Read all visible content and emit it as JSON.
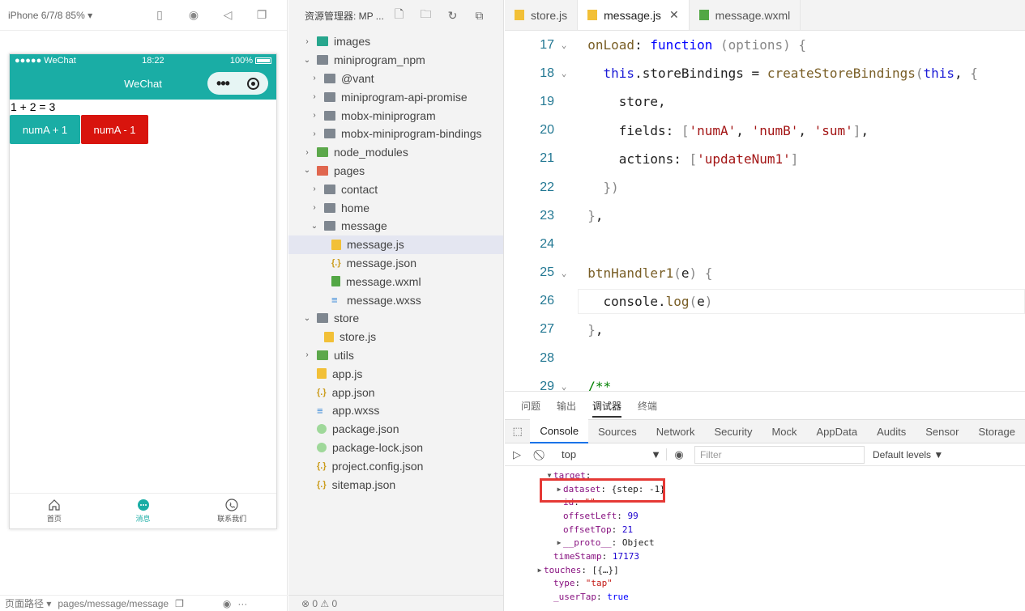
{
  "simulator": {
    "device": "iPhone 6/7/8 85% ▾",
    "status": {
      "carrier": "●●●●● WeChat",
      "time": "18:22",
      "battery": "100%"
    },
    "nav_title": "WeChat",
    "sum_text": "1 + 2 = 3",
    "btn_plus": "numA + 1",
    "btn_minus": "numA - 1",
    "tabbar": [
      {
        "label": "首页"
      },
      {
        "label": "消息"
      },
      {
        "label": "联系我们"
      }
    ],
    "footer_label": "页面路径 ▾",
    "footer_path": "pages/message/message"
  },
  "explorer": {
    "title": "资源管理器: MP ...",
    "footer_status": "⊗ 0 ⚠ 0",
    "tree": [
      {
        "label": "images",
        "depth": 0,
        "chev": "›",
        "icon": "folder img"
      },
      {
        "label": "miniprogram_npm",
        "depth": 0,
        "chev": "⌄",
        "icon": "folder"
      },
      {
        "label": "@vant",
        "depth": 1,
        "chev": "›",
        "icon": "folder"
      },
      {
        "label": "miniprogram-api-promise",
        "depth": 1,
        "chev": "›",
        "icon": "folder"
      },
      {
        "label": "mobx-miniprogram",
        "depth": 1,
        "chev": "›",
        "icon": "folder"
      },
      {
        "label": "mobx-miniprogram-bindings",
        "depth": 1,
        "chev": "›",
        "icon": "folder"
      },
      {
        "label": "node_modules",
        "depth": 0,
        "chev": "›",
        "icon": "folder green"
      },
      {
        "label": "pages",
        "depth": 0,
        "chev": "⌄",
        "icon": "folder red"
      },
      {
        "label": "contact",
        "depth": 1,
        "chev": "›",
        "icon": "folder"
      },
      {
        "label": "home",
        "depth": 1,
        "chev": "›",
        "icon": "folder"
      },
      {
        "label": "message",
        "depth": 1,
        "chev": "⌄",
        "icon": "folder"
      },
      {
        "label": "message.js",
        "depth": 2,
        "chev": "",
        "icon": "fjs",
        "selected": true
      },
      {
        "label": "message.json",
        "depth": 2,
        "chev": "",
        "icon": "fjson"
      },
      {
        "label": "message.wxml",
        "depth": 2,
        "chev": "",
        "icon": "fwxml"
      },
      {
        "label": "message.wxss",
        "depth": 2,
        "chev": "",
        "icon": "fwxss"
      },
      {
        "label": "store",
        "depth": 0,
        "chev": "⌄",
        "icon": "folder"
      },
      {
        "label": "store.js",
        "depth": 1,
        "chev": "",
        "icon": "fjs"
      },
      {
        "label": "utils",
        "depth": 0,
        "chev": "›",
        "icon": "folder green"
      },
      {
        "label": "app.js",
        "depth": 0,
        "chev": "",
        "icon": "fjs"
      },
      {
        "label": "app.json",
        "depth": 0,
        "chev": "",
        "icon": "fjson"
      },
      {
        "label": "app.wxss",
        "depth": 0,
        "chev": "",
        "icon": "fwxss"
      },
      {
        "label": "package.json",
        "depth": 0,
        "chev": "",
        "icon": "fpkg"
      },
      {
        "label": "package-lock.json",
        "depth": 0,
        "chev": "",
        "icon": "fpkg"
      },
      {
        "label": "project.config.json",
        "depth": 0,
        "chev": "",
        "icon": "fjson"
      },
      {
        "label": "sitemap.json",
        "depth": 0,
        "chev": "",
        "icon": "fjson"
      }
    ]
  },
  "editor": {
    "tabs": [
      {
        "label": "store.js",
        "icon": "fjs"
      },
      {
        "label": "message.js",
        "icon": "fjs",
        "active": true
      },
      {
        "label": "message.wxml",
        "icon": "fwxml"
      }
    ],
    "lines": [
      {
        "n": "17",
        "fold": "⌄",
        "code": "  <span class='f'>onLoad</span>: <span class='kw2'>function</span> <span class='p'>(options)</span> <span class='p'>{</span>"
      },
      {
        "n": "18",
        "fold": "⌄",
        "code": "    <span class='k'>this</span>.storeBindings = <span class='f'>createStoreBindings</span><span class='p'>(</span><span class='k'>this</span>, <span class='p'>{</span>"
      },
      {
        "n": "19",
        "fold": "",
        "code": "      store,"
      },
      {
        "n": "20",
        "fold": "",
        "code": "      fields: <span class='p'>[</span><span class='s'>'numA'</span>, <span class='s'>'numB'</span>, <span class='s'>'sum'</span><span class='p'>]</span>,"
      },
      {
        "n": "21",
        "fold": "",
        "code": "      actions: <span class='p'>[</span><span class='s'>'updateNum1'</span><span class='p'>]</span>"
      },
      {
        "n": "22",
        "fold": "",
        "code": "    <span class='p'>})</span>"
      },
      {
        "n": "23",
        "fold": "",
        "code": "  <span class='p'>}</span>,"
      },
      {
        "n": "24",
        "fold": "",
        "code": ""
      },
      {
        "n": "25",
        "fold": "⌄",
        "code": "  <span class='f'>btnHandler1</span><span class='p'>(</span>e<span class='p'>)</span> <span class='p'>{</span>"
      },
      {
        "n": "26",
        "fold": "",
        "code": "    console.<span class='f'>log</span><span class='p'>(</span>e<span class='p'>)</span>",
        "current": true
      },
      {
        "n": "27",
        "fold": "",
        "code": "  <span class='p'>}</span>,"
      },
      {
        "n": "28",
        "fold": "",
        "code": ""
      },
      {
        "n": "29",
        "fold": "⌄",
        "code": "  <span class='cmt'>/**</span>"
      }
    ]
  },
  "debug": {
    "tabs": [
      "问题",
      "输出",
      "调试器",
      "终端"
    ],
    "active_tab": "调试器",
    "console_tabs": [
      "Console",
      "Sources",
      "Network",
      "Security",
      "Mock",
      "AppData",
      "Audits",
      "Sensor",
      "Storage"
    ],
    "context": "top",
    "filter_placeholder": "Filter",
    "levels": "Default levels ▼",
    "output": [
      {
        "indent": 2,
        "tri": "▼",
        "html": "<span class='key'>target</span>:"
      },
      {
        "indent": 3,
        "tri": "▶",
        "html": "<span class='key'>dataset</span>: {step: -1}"
      },
      {
        "indent": 3,
        "tri": "",
        "html": "<span class='key'>id</span>: <span class='str'>\"\"</span>"
      },
      {
        "indent": 3,
        "tri": "",
        "html": "<span class='key'>offsetLeft</span>: <span class='num'>99</span>"
      },
      {
        "indent": 3,
        "tri": "",
        "html": "<span class='key'>offsetTop</span>: <span class='num'>21</span>"
      },
      {
        "indent": 3,
        "tri": "▶",
        "html": "<span class='key'>__proto__</span>: Object"
      },
      {
        "indent": 2,
        "tri": "",
        "html": "<span class='key'>timeStamp</span>: <span class='num'>17173</span>"
      },
      {
        "indent": 1,
        "tri": "▶",
        "html": "<span class='key'>touches</span>: [{…}]"
      },
      {
        "indent": 2,
        "tri": "",
        "html": "<span class='key'>type</span>: <span class='str'>\"tap\"</span>"
      },
      {
        "indent": 2,
        "tri": "",
        "html": "<span class='key'>_userTap</span>: <span class='kw2'>true</span>"
      }
    ]
  },
  "colors": {
    "brand": "#1aada5",
    "danger": "#d8140d",
    "highlight": "#e53935"
  }
}
